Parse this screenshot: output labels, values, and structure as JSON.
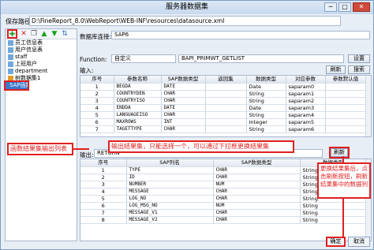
{
  "window": {
    "title": "服务器数据集"
  },
  "path": {
    "label": "保存路径:",
    "value": "D:\\FineReport_8.0\\WebReport\\WEB-INF\\resources\\datasource.xml"
  },
  "toolbar": {
    "icons": [
      "add-icon",
      "delete-icon",
      "copy-icon",
      "move-up-icon",
      "move-down-icon",
      "sort-icon"
    ]
  },
  "tree": {
    "items": [
      "员工信息表",
      "用户信息表",
      "staff",
      "上班用户",
      "department",
      "树数据集1",
      "SAP函数"
    ],
    "selected_index": 6
  },
  "form": {
    "db_label": "数据库连接:",
    "db_value": "SAP6",
    "function_label": "Function:",
    "function_type": "自定义",
    "function_name": "BAPI_PRIMWT_GETLIST",
    "settings_button": "设置",
    "input_label": "输入:",
    "refresh_button": "刷新",
    "search_button": "搜索"
  },
  "input_table": {
    "headers": [
      "序号",
      "参数名称",
      "SAP数据类型",
      "返回集",
      "数据类型",
      "对应参数",
      "参数默认值"
    ],
    "rows": [
      [
        "1",
        "BEGDA",
        "DATE",
        "",
        "Date",
        "saparam0",
        ""
      ],
      [
        "2",
        "COUNTRYDEN",
        "CHAR",
        "",
        "String",
        "saparam1",
        ""
      ],
      [
        "3",
        "COUNTRYISO",
        "CHAR",
        "",
        "String",
        "saparam2",
        ""
      ],
      [
        "4",
        "ENDDA",
        "DATE",
        "",
        "Date",
        "saparam3",
        ""
      ],
      [
        "5",
        "LANGUAGEISO",
        "CHAR",
        "",
        "String",
        "saparam4",
        ""
      ],
      [
        "6",
        "MAXROWS",
        "INT",
        "",
        "Integer",
        "saparam5",
        ""
      ],
      [
        "7",
        "TAGETTYPE",
        "CHAR",
        "",
        "String",
        "saparam6",
        ""
      ]
    ]
  },
  "output": {
    "label": "输出:",
    "value": "RETURN",
    "refresh_button": "刷新"
  },
  "output_table": {
    "headers": [
      "序号",
      "SAP列名",
      "SAP数据类型",
      "数据类型"
    ],
    "rows": [
      [
        "1",
        "TYPE",
        "CHAR",
        "String"
      ],
      [
        "2",
        "ID",
        "CHAR",
        "String"
      ],
      [
        "3",
        "NUMBER",
        "NUM",
        "String"
      ],
      [
        "4",
        "MESSAGE",
        "CHAR",
        "String"
      ],
      [
        "5",
        "LOG_NO",
        "CHAR",
        "String"
      ],
      [
        "6",
        "LOG_MSG_NO",
        "NUM",
        "String"
      ],
      [
        "7",
        "MESSAGE_V1",
        "CHAR",
        "String"
      ],
      [
        "8",
        "MESSAGE_V2",
        "CHAR",
        "String"
      ]
    ]
  },
  "annotations": {
    "func_output": "函数结果集输出列表",
    "output_select": "输出结果集，只能选择一个，可以通过下拉框更换结果集",
    "refresh_hint": "更换结果集后，点击刷新按钮，刷新结果集中的数据列"
  },
  "buttons": {
    "ok": "确定",
    "cancel": "取消"
  }
}
